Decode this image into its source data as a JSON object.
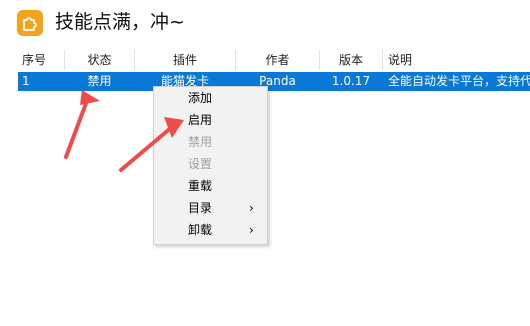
{
  "header": {
    "title": "技能点满，冲~"
  },
  "table": {
    "columns": [
      "序号",
      "状态",
      "插件",
      "作者",
      "版本",
      "说明"
    ],
    "rows": [
      {
        "index": "1",
        "status": "禁用",
        "plugin": "能猫发卡",
        "author": "Panda",
        "version": "1.0.17",
        "description": "全能自动发卡平台，支持代"
      }
    ]
  },
  "context_menu": {
    "items": [
      {
        "label": "添加",
        "enabled": true,
        "submenu": false
      },
      {
        "label": "启用",
        "enabled": true,
        "submenu": false
      },
      {
        "label": "禁用",
        "enabled": false,
        "submenu": false
      },
      {
        "label": "设置",
        "enabled": false,
        "submenu": false
      },
      {
        "label": "重载",
        "enabled": true,
        "submenu": false
      },
      {
        "label": "目录",
        "enabled": true,
        "submenu": true
      },
      {
        "label": "卸载",
        "enabled": true,
        "submenu": true
      }
    ],
    "submenu_glyph": "›"
  },
  "colors": {
    "selection": "#0a78d7",
    "annotation_arrow": "#ee4b4b",
    "app_icon": "#f6a21a"
  }
}
